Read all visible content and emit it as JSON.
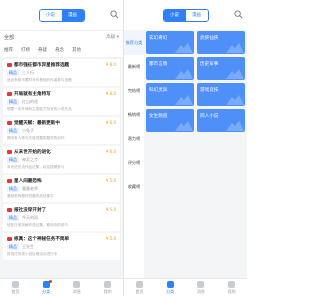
{
  "left": {
    "segment": {
      "a": "小说",
      "b": "漫画"
    },
    "filter": {
      "category": "全部",
      "sort": "高级 ▾"
    },
    "tabs": [
      "推荐",
      "打榜",
      "悬疑",
      "悬念",
      "其他"
    ],
    "cards": [
      {
        "title": "都市强征都市异星推荐选题",
        "reward": "¥ 8.0",
        "tag": "精品",
        "author": "三人行",
        "desc": "适合有都市题材写作基础的作者参与投稿"
      },
      {
        "title": "开局就有主角特写",
        "reward": "¥ 8.0",
        "tag": "精品",
        "author": "红山的花",
        "desc": "想要一本开局有主角能力特写的小说作品"
      },
      {
        "title": "觉醒天赋：最新更新中",
        "reward": "¥ 6.0",
        "tag": "精品",
        "author": "小兔子",
        "desc": "期待有人参与天赋觉醒类题材的创作"
      },
      {
        "title": "从末世开始的进化",
        "reward": "¥ 6.0",
        "tag": "精品",
        "author": "神武之才",
        "desc": "末世进化流作品征集，欢迎投稿参与"
      },
      {
        "title": "星人间最恐怖",
        "reward": "¥ 5.0",
        "tag": "精品",
        "author": "墨墨老师",
        "desc": "悬疑恐怖题材短篇作品征集中"
      },
      {
        "title": "报社没穿开封了",
        "reward": "¥ 5.0",
        "tag": "精品",
        "author": "今天的雨",
        "desc": "轻松日常风格作品征集，期待你的参与"
      },
      {
        "title": "修真：这个神秘任务不简单",
        "reward": "¥ 5.0",
        "tag": "精品",
        "author": "王先生",
        "desc": "修真任务类小说征稿活动进行中"
      }
    ]
  },
  "right": {
    "segment": {
      "a": "小说",
      "b": "漫画"
    },
    "side": [
      "推荐分类",
      "最新榜",
      "完结榜",
      "畅销榜",
      "潜力榜",
      "评分榜",
      "收藏榜"
    ],
    "tiles": [
      {
        "name": "玄幻奇幻",
        "count": ""
      },
      {
        "name": "武侠仙侠",
        "count": ""
      },
      {
        "name": "都市言情",
        "count": ""
      },
      {
        "name": "历史军事",
        "count": ""
      },
      {
        "name": "科幻灵异",
        "count": ""
      },
      {
        "name": "游戏竞技",
        "count": ""
      },
      {
        "name": "女生频道",
        "count": ""
      },
      {
        "name": "同人小说",
        "count": ""
      }
    ]
  },
  "nav": [
    "首页",
    "分类",
    "消息",
    "我的"
  ]
}
